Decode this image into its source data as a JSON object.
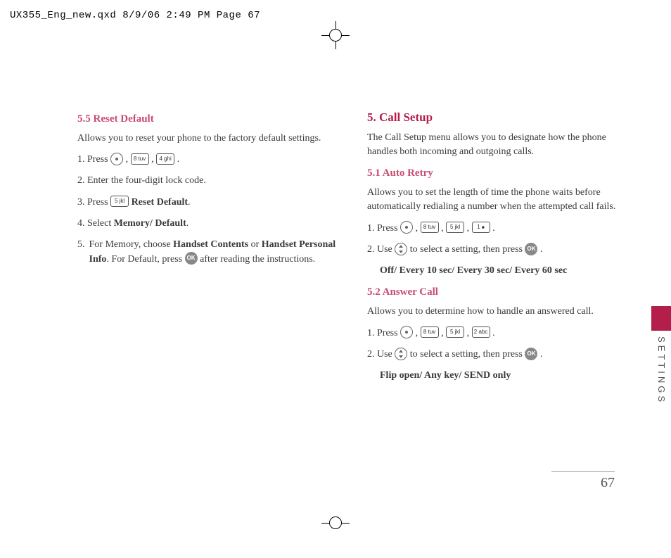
{
  "header": "UX355_Eng_new.qxd  8/9/06  2:49 PM  Page 67",
  "side_label": "SETTINGS",
  "page_number": "67",
  "left": {
    "h55": "5.5 Reset Default",
    "p55": "Allows you to reset your phone to the factory default settings.",
    "s1a": "1. Press ",
    "s2": "2. Enter the four-digit lock code.",
    "s3a": "3. Press ",
    "s3b": " Reset Default",
    "s4a": "4. Select ",
    "s4b": "Memory/ Default",
    "s5a": "5. For Memory, choose ",
    "s5b": "Handset Contents",
    "s5c": " or ",
    "s5d": "Handset Personal Info",
    "s5e": ". For Default, press ",
    "s5f": " after reading the instructions."
  },
  "right": {
    "h5": "5. Call Setup",
    "p5": "The Call Setup menu allows you to designate how the phone handles both incoming and outgoing calls.",
    "h51": "5.1 Auto Retry",
    "p51": "Allows you to set the length of time the phone waits before automatically redialing a number when the attempted call fails.",
    "r1_1a": "1. Press ",
    "r1_2a": "2. Use ",
    "r1_2b": " to select a setting, then press ",
    "r1_opt": "Off/ Every 10 sec/ Every 30 sec/ Every 60 sec",
    "h52": "5.2 Answer Call",
    "p52": "Allows you to determine how to handle an answered call.",
    "r2_1a": "1. Press ",
    "r2_2a": "2. Use ",
    "r2_2b": " to select a setting, then press ",
    "r2_opt": "Flip open/ Any key/ SEND only"
  },
  "keys": {
    "k8": "8 tuv",
    "k4": "4 ghi",
    "k5": "5 jkl",
    "k1": "1 ⦁",
    "k2": "2 abc",
    "ok": "OK"
  }
}
